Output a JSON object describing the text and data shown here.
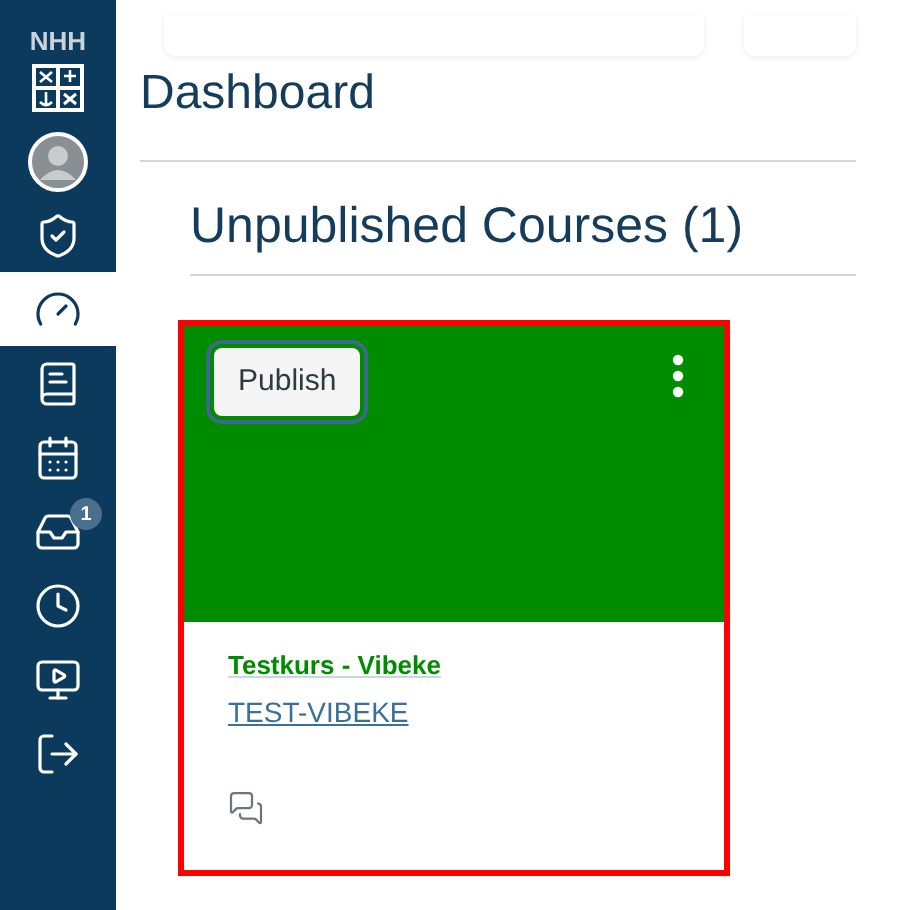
{
  "sidebar": {
    "logo_text": "NHH",
    "items": [
      {
        "kind": "avatar",
        "selected": false
      },
      {
        "kind": "admin",
        "selected": false
      },
      {
        "kind": "dashboard",
        "selected": true
      },
      {
        "kind": "courses",
        "selected": false
      },
      {
        "kind": "calendar",
        "selected": false
      },
      {
        "kind": "inbox",
        "selected": false,
        "badge": "1"
      },
      {
        "kind": "history",
        "selected": false
      },
      {
        "kind": "studio",
        "selected": false
      },
      {
        "kind": "logout",
        "selected": false
      }
    ]
  },
  "page_title": "Dashboard",
  "section_title": "Unpublished Courses (1)",
  "course_card": {
    "publish_button": "Publish",
    "color": "#008c00",
    "name": "Testkurs - Vibeke",
    "code": "TEST-VIBEKE",
    "highlighted": true
  }
}
